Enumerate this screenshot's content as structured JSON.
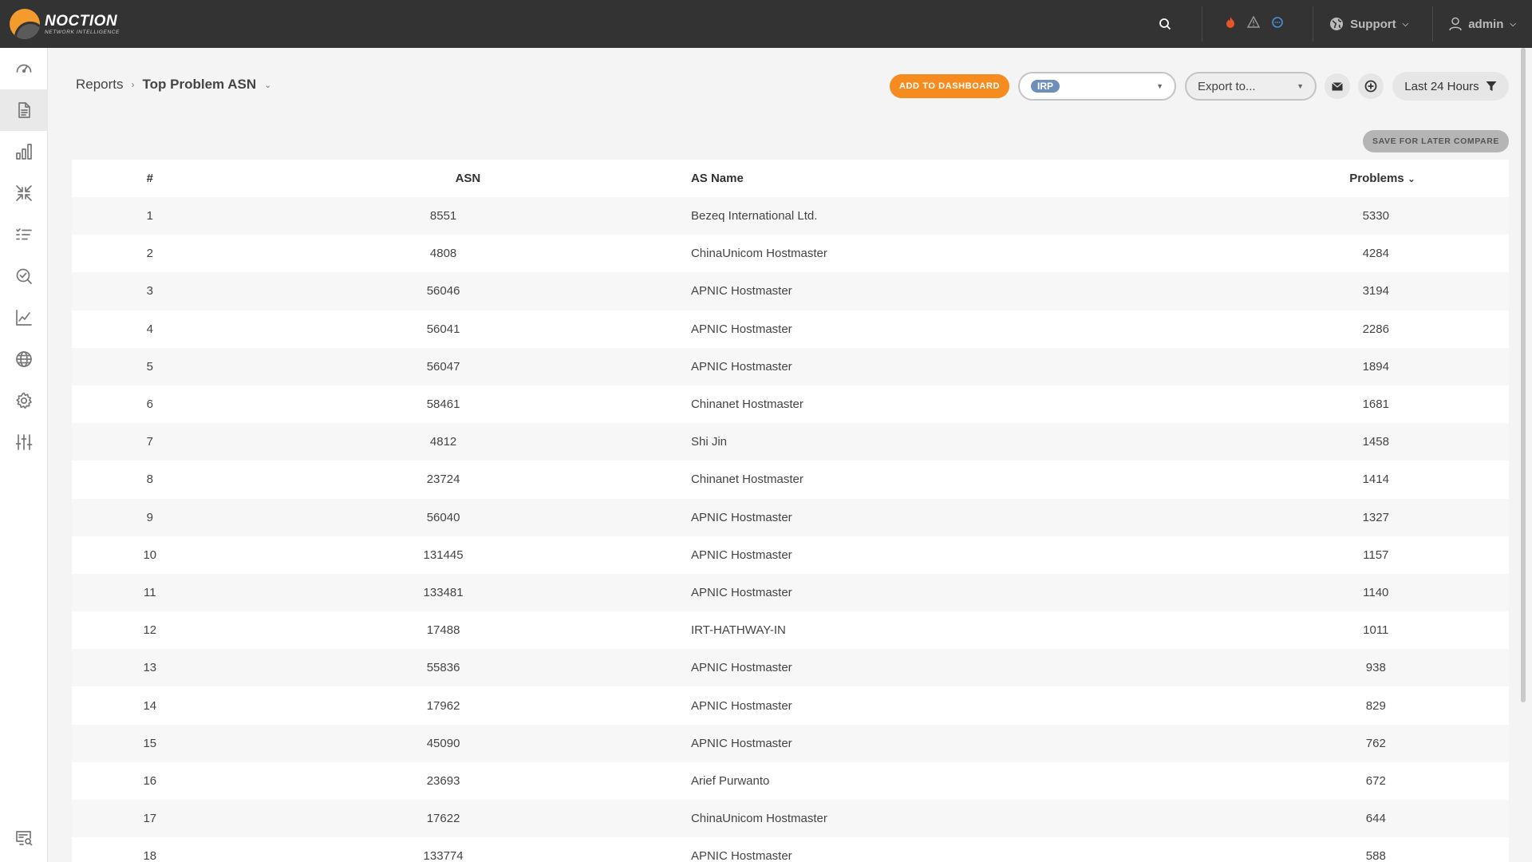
{
  "brand": {
    "name": "NOCTION",
    "tagline": "NETWORK INTELLIGENCE",
    "accent": "#f68b1f"
  },
  "topbar": {
    "search_icon": "search-icon",
    "alert_icons": [
      "fire-icon",
      "warning-icon",
      "chat-icon"
    ],
    "support_label": "Support",
    "user_label": "admin"
  },
  "sidebar": {
    "items": [
      {
        "icon": "dashboard-gauge-icon",
        "active": false
      },
      {
        "icon": "reports-document-icon",
        "active": true
      },
      {
        "icon": "bar-chart-icon",
        "active": false
      },
      {
        "icon": "compress-arrows-icon",
        "active": false
      },
      {
        "icon": "checklist-icon",
        "active": false
      },
      {
        "icon": "search-check-icon",
        "active": false
      },
      {
        "icon": "line-graph-icon",
        "active": false
      },
      {
        "icon": "globe-icon",
        "active": false
      },
      {
        "icon": "gear-icon",
        "active": false
      },
      {
        "icon": "sliders-icon",
        "active": false
      }
    ],
    "bottom_icon": "monitor-search-icon"
  },
  "breadcrumb": {
    "root": "Reports",
    "current": "Top Problem ASN"
  },
  "toolbar": {
    "add_dashboard_label": "ADD TO DASHBOARD",
    "irp_tag": "IRP",
    "export_placeholder": "Export to...",
    "time_label": "Last 24 Hours",
    "save_compare_label": "SAVE FOR LATER COMPARE"
  },
  "table": {
    "headers": {
      "num": "#",
      "asn": "ASN",
      "name": "AS Name",
      "problems": "Problems"
    },
    "rows": [
      {
        "num": "1",
        "asn": "8551",
        "name": "Bezeq International Ltd.",
        "problems": "5330"
      },
      {
        "num": "2",
        "asn": "4808",
        "name": "ChinaUnicom Hostmaster",
        "problems": "4284"
      },
      {
        "num": "3",
        "asn": "56046",
        "name": "APNIC Hostmaster",
        "problems": "3194"
      },
      {
        "num": "4",
        "asn": "56041",
        "name": "APNIC Hostmaster",
        "problems": "2286"
      },
      {
        "num": "5",
        "asn": "56047",
        "name": "APNIC Hostmaster",
        "problems": "1894"
      },
      {
        "num": "6",
        "asn": "58461",
        "name": "Chinanet Hostmaster",
        "problems": "1681"
      },
      {
        "num": "7",
        "asn": "4812",
        "name": "Shi Jin",
        "problems": "1458"
      },
      {
        "num": "8",
        "asn": "23724",
        "name": "Chinanet Hostmaster",
        "problems": "1414"
      },
      {
        "num": "9",
        "asn": "56040",
        "name": "APNIC Hostmaster",
        "problems": "1327"
      },
      {
        "num": "10",
        "asn": "131445",
        "name": "APNIC Hostmaster",
        "problems": "1157"
      },
      {
        "num": "11",
        "asn": "133481",
        "name": "APNIC Hostmaster",
        "problems": "1140"
      },
      {
        "num": "12",
        "asn": "17488",
        "name": "IRT-HATHWAY-IN",
        "problems": "1011"
      },
      {
        "num": "13",
        "asn": "55836",
        "name": "APNIC Hostmaster",
        "problems": "938"
      },
      {
        "num": "14",
        "asn": "17962",
        "name": "APNIC Hostmaster",
        "problems": "829"
      },
      {
        "num": "15",
        "asn": "45090",
        "name": "APNIC Hostmaster",
        "problems": "762"
      },
      {
        "num": "16",
        "asn": "23693",
        "name": "Arief Purwanto",
        "problems": "672"
      },
      {
        "num": "17",
        "asn": "17622",
        "name": "ChinaUnicom Hostmaster",
        "problems": "644"
      },
      {
        "num": "18",
        "asn": "133774",
        "name": "APNIC Hostmaster",
        "problems": "588"
      }
    ]
  }
}
